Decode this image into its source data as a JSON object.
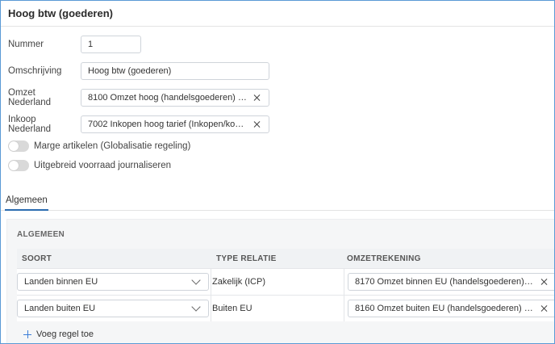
{
  "title": "Hoog btw (goederen)",
  "form": {
    "nummer": {
      "label": "Nummer",
      "value": "1"
    },
    "omschrijving": {
      "label": "Omschrijving",
      "value": "Hoog btw (goederen)"
    },
    "omzet_nl": {
      "label": "Omzet Nederland",
      "value": "8100 Omzet hoog (handelsgoederen) (Verkopen..."
    },
    "inkoop_nl": {
      "label": "Inkoop Nederland",
      "value": "7002 Inkopen hoog tarief (Inkopen/kosten hoog..."
    }
  },
  "toggles": [
    {
      "label": "Marge artikelen (Globalisatie regeling)",
      "on": false
    },
    {
      "label": "Uitgebreid voorraad journaliseren",
      "on": false
    }
  ],
  "tabs": {
    "active": "Algemeen"
  },
  "section": {
    "title": "ALGEMEEN",
    "columns": [
      "SOORT",
      "TYPE RELATIE",
      "OMZETREKENING"
    ],
    "rows": [
      {
        "soort": "Landen binnen EU",
        "type_relatie": "Zakelijk (ICP)",
        "omzetrekening": "8170 Omzet binnen EU (handelsgoederen) (Verkopen ..."
      },
      {
        "soort": "Landen buiten EU",
        "type_relatie": "Buiten EU",
        "omzetrekening": "8160 Omzet buiten EU (handelsgoederen) (Verkopen ..."
      }
    ],
    "add_label": "Voeg regel toe"
  },
  "colors": {
    "accent": "#2b6cb0",
    "border": "#5a9ad5"
  }
}
